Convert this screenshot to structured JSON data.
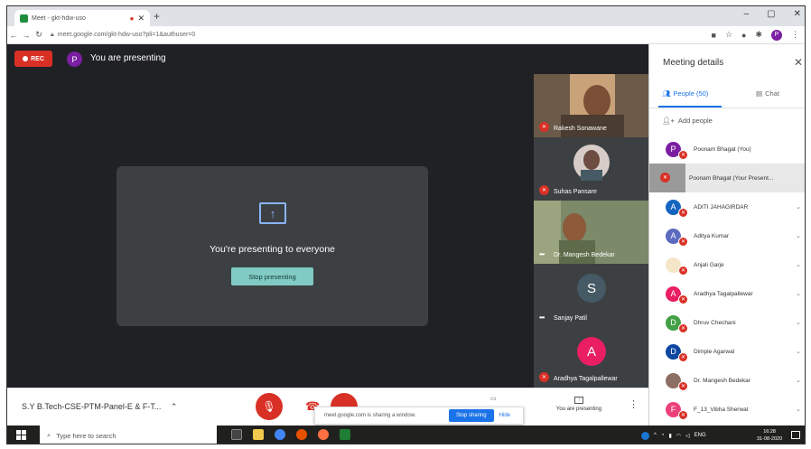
{
  "browser": {
    "tab_title": "Meet - gkt-hdw-uso",
    "url": "meet.google.com/gkt-hdw-uso?pli=1&authuser=0",
    "new_tab": "+",
    "profile_initial": "P",
    "window_controls": [
      "–",
      "▢",
      "✕"
    ]
  },
  "meet": {
    "rec_label": "REC",
    "presenter_initial": "P",
    "presenting_label": "You are presenting",
    "card_text": "You're presenting to everyone",
    "stop_presenting": "Stop presenting"
  },
  "tiles": [
    {
      "name": "Rakesh Sonawane",
      "muted": true
    },
    {
      "name": "Suhas Pansare",
      "muted": true
    },
    {
      "name": "Dr. Mangesh Bedekar",
      "muted": false
    },
    {
      "name": "Sanjay Patil",
      "initial": "S",
      "color": "#455a64",
      "muted": false
    },
    {
      "name": "Aradhya Tagalpallewar",
      "initial": "A",
      "color": "#e91e63",
      "muted": true
    }
  ],
  "panel": {
    "title": "Meeting details",
    "tab_people": "People (50)",
    "tab_chat": "Chat",
    "add_people": "Add people",
    "people": [
      {
        "name": "Poonam Bhagat (You)",
        "initial": "P",
        "color": "#7b1fa2"
      },
      {
        "name": "Poonam Bhagat (Your Present...",
        "thumb": true
      },
      {
        "name": "ADITI JAHAGIRDAR",
        "initial": "A",
        "color": "#1565c0"
      },
      {
        "name": "Aditya Kumar",
        "initial": "A",
        "color": "#5c6bc0"
      },
      {
        "name": "Anjali Garje",
        "initial": "",
        "color": "#f5e6c8"
      },
      {
        "name": "Aradhya Tagalpallewar",
        "initial": "A",
        "color": "#e91e63"
      },
      {
        "name": "Dhruv Chechani",
        "initial": "D",
        "color": "#43a047"
      },
      {
        "name": "Dimple Agarwal",
        "initial": "D",
        "color": "#0d47a1"
      },
      {
        "name": "Dr. Mangesh Bedekar",
        "initial": "",
        "color": "#8d6e63"
      },
      {
        "name": "F_13_Vibha Sherwal",
        "initial": "F",
        "color": "#ec407a"
      }
    ]
  },
  "controls": {
    "meeting_title": "S.Y B.Tech-CSE-PTM-Panel-E & F-T...",
    "share_text": "meet.google.com is sharing a window.",
    "stop_sharing": "Stop sharing",
    "hide": "Hide",
    "present_now": "You are presenting"
  },
  "taskbar": {
    "search_placeholder": "Type here to search",
    "lang": "ENG",
    "time": "16:28",
    "date": "31-08-2020"
  }
}
